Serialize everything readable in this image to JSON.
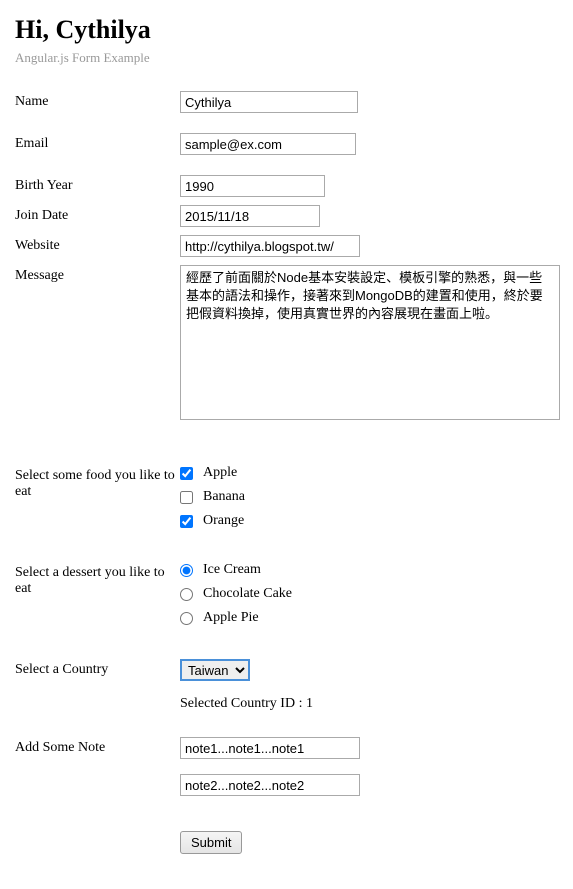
{
  "header": {
    "title": "Hi, Cythilya",
    "subtitle": "Angular.js Form Example"
  },
  "form": {
    "name": {
      "label": "Name",
      "value": "Cythilya"
    },
    "email": {
      "label": "Email",
      "value": "sample@ex.com"
    },
    "birthYear": {
      "label": "Birth Year",
      "value": "1990"
    },
    "joinDate": {
      "label": "Join Date",
      "value": "2015/11/18"
    },
    "website": {
      "label": "Website",
      "value": "http://cythilya.blogspot.tw/"
    },
    "message": {
      "label": "Message",
      "value": "經歷了前面關於Node基本安裝設定、模板引擎的熟悉，與一些基本的語法和操作，接著來到MongoDB的建置和使用，終於要把假資料換掉，使用真實世界的內容展現在畫面上啦。"
    },
    "food": {
      "label": "Select some food you like to eat",
      "options": [
        {
          "label": "Apple",
          "checked": true
        },
        {
          "label": "Banana",
          "checked": false
        },
        {
          "label": "Orange",
          "checked": true
        }
      ]
    },
    "dessert": {
      "label": "Select a dessert you like to eat",
      "options": [
        {
          "label": "Ice Cream",
          "checked": true
        },
        {
          "label": "Chocolate Cake",
          "checked": false
        },
        {
          "label": "Apple Pie",
          "checked": false
        }
      ]
    },
    "country": {
      "label": "Select a Country",
      "selected": "Taiwan",
      "selectedText": "Selected Country ID : 1"
    },
    "notes": {
      "label": "Add Some Note",
      "values": [
        "note1...note1...note1",
        "note2...note2...note2"
      ]
    },
    "submit": {
      "label": "Submit"
    }
  }
}
